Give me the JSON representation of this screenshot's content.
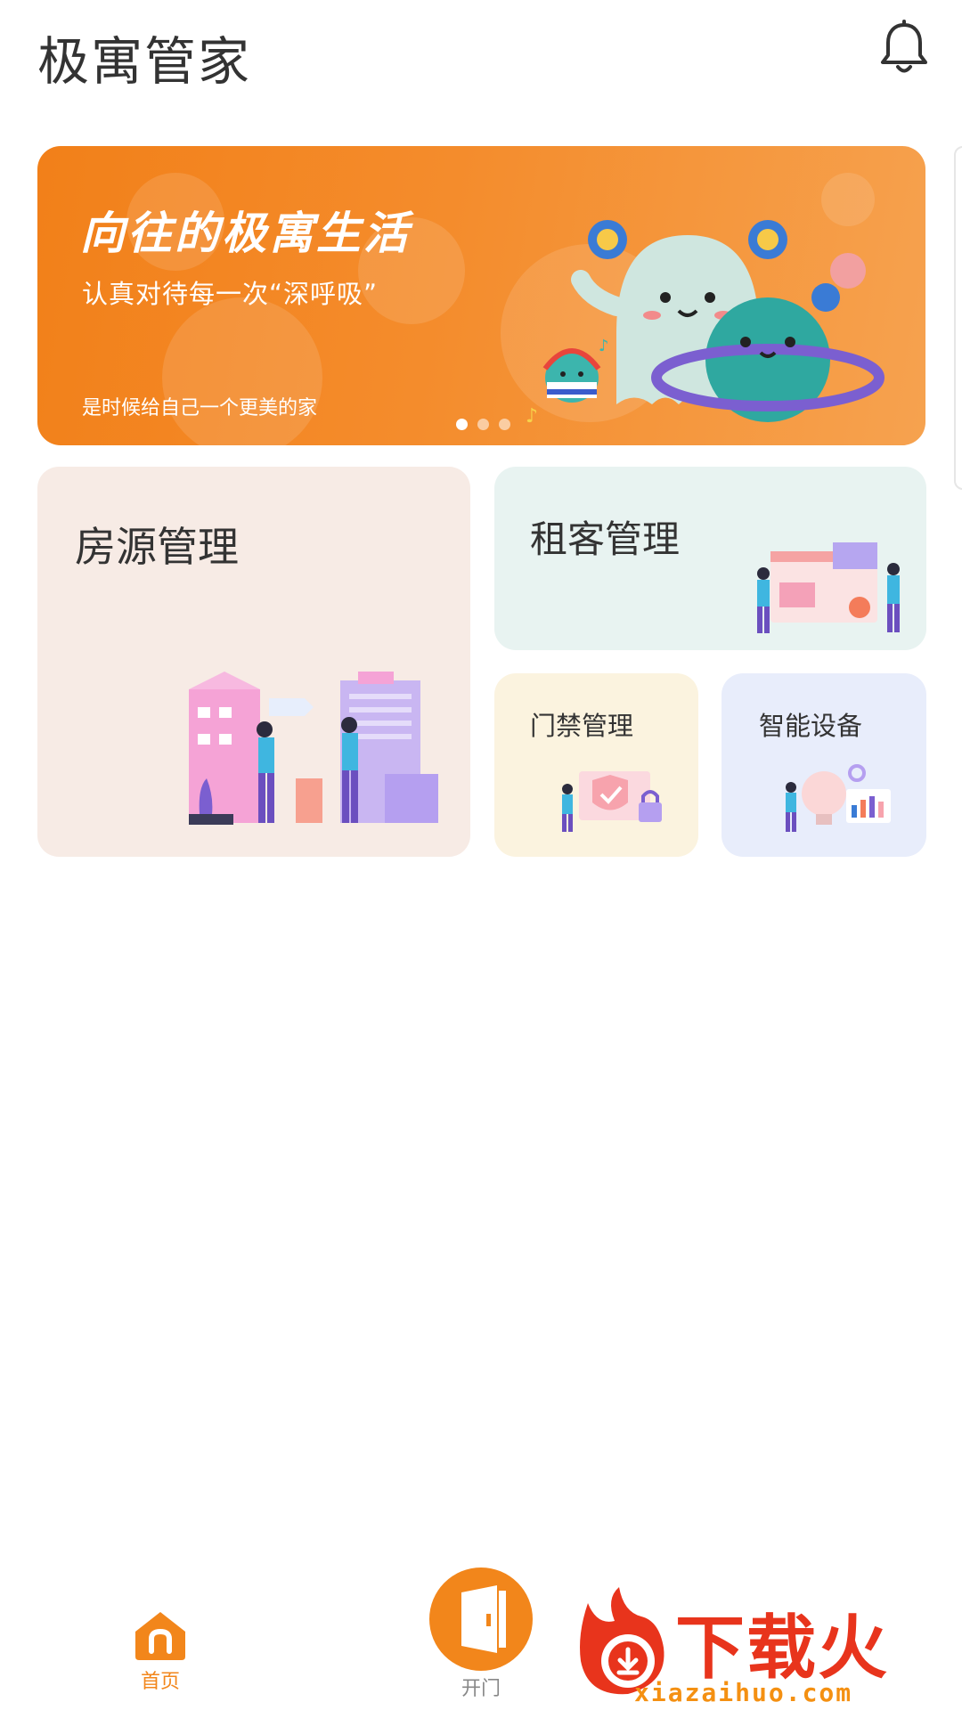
{
  "header": {
    "title": "极寓管家",
    "bell_icon": "bell-icon"
  },
  "banner": {
    "title": "向往的极寓生活",
    "subtitle": "认真对待每一次“深呼吸”",
    "note": "是时候给自己一个更美的家",
    "slides_total": 3,
    "active_slide": 1,
    "colors": {
      "start": "#f28019",
      "end": "#f6a24f"
    }
  },
  "modules": {
    "property": {
      "label": "房源管理",
      "color": "#f7ebe5"
    },
    "tenant": {
      "label": "租客管理",
      "color": "#e8f3f1"
    },
    "door": {
      "label": "门禁管理",
      "color": "#fbf3df"
    },
    "device": {
      "label": "智能设备",
      "color": "#e8edfb"
    }
  },
  "tabbar": {
    "home": {
      "label": "首页",
      "icon": "home-icon",
      "active": true
    },
    "open": {
      "label": "开门",
      "icon": "door-icon"
    },
    "accent": "#f2861b"
  },
  "watermark": {
    "logo_text": "下载火",
    "site": "xiazaihuo.com"
  }
}
